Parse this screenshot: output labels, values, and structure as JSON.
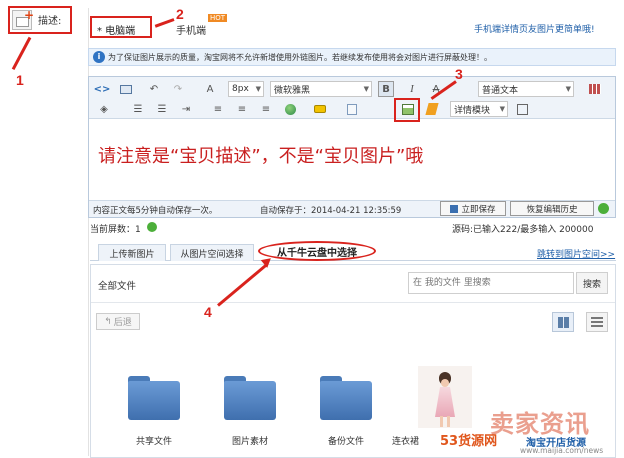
{
  "left": {
    "label": "描述:"
  },
  "device_tabs": {
    "pc": "* 电脑端",
    "mobile": "手机端",
    "hot": "HOT"
  },
  "mobile_link": "手机端详情页友图片更简单哦!",
  "notice": "为了保证图片展示的质量，淘宝网将不允许新增使用外链图片。若继续发布使用将会对图片进行屏蔽处理！。",
  "toolbar": {
    "font_size": "8px",
    "font_family": "微软雅黑",
    "bold": "B",
    "italic": "I",
    "strike": "A",
    "paragraph": "普通文本",
    "detail_module": "详情模块"
  },
  "editor": {
    "content": "请注意是“宝贝描述”，不是“宝贝图片”哦"
  },
  "statusbar": {
    "autosave_note": "内容正文每5分钟自动保存一次。",
    "autosave_time": "自动保存于：2014-04-21 12:35:59",
    "save_now": "立即保存",
    "restore": "恢复编辑历史"
  },
  "screen_info": {
    "label": "当前屏数：1",
    "count": "源码:已输入222/最多输入 200000"
  },
  "image_tabs": {
    "items": [
      "上传新图片",
      "从图片空间选择",
      "从千牛云盘中选择"
    ],
    "jump_link": "跳转到图片空间>>"
  },
  "browser": {
    "breadcrumb": "全部文件",
    "search_placeholder": "在 我的文件 里搜索",
    "search_button": "搜索",
    "back": "后退",
    "files": [
      "共享文件",
      "图片素材",
      "备份文件",
      "连衣裙"
    ]
  },
  "annotations": [
    "1",
    "2",
    "3",
    "4"
  ],
  "watermark": {
    "big": "卖家资讯",
    "site": "53货源网",
    "sub": "淘宝开店货源",
    "url": "www.maijia.com/news"
  },
  "colors": {
    "accent_red": "#d9231d",
    "link_blue": "#1f5fa8",
    "toolbar_bg": "#eef3f9"
  }
}
